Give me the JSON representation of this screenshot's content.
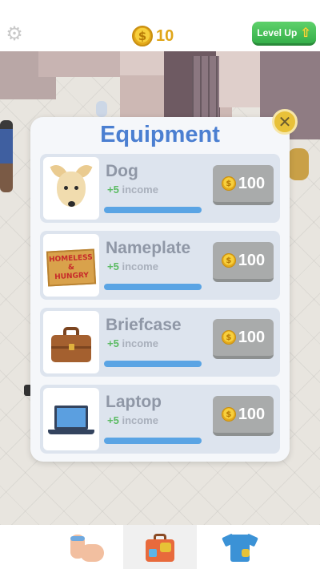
{
  "hud": {
    "settings_icon": "gear-icon",
    "coin_symbol": "$",
    "coin_balance": "10",
    "level_up_label": "Level Up",
    "level_up_arrow": "⇧"
  },
  "modal": {
    "title": "Equipment",
    "close_symbol": "✕"
  },
  "items": [
    {
      "name": "Dog",
      "income_plus": "+5",
      "income_word": "income",
      "coin_symbol": "$",
      "price": "100",
      "progress": 1.0,
      "icon": "dog-icon"
    },
    {
      "name": "Nameplate",
      "income_plus": "+5",
      "income_word": "income",
      "coin_symbol": "$",
      "price": "100",
      "progress": 1.0,
      "icon": "nameplate-icon",
      "sign_lines": [
        "HOMELESS",
        "&",
        "HUNGRY"
      ]
    },
    {
      "name": "Briefcase",
      "income_plus": "+5",
      "income_word": "income",
      "coin_symbol": "$",
      "price": "100",
      "progress": 1.0,
      "icon": "briefcase-icon"
    },
    {
      "name": "Laptop",
      "income_plus": "+5",
      "income_word": "income",
      "coin_symbol": "$",
      "price": "100",
      "progress": 1.0,
      "icon": "laptop-icon"
    }
  ],
  "nav": {
    "tabs": [
      {
        "icon": "muscle-icon",
        "active": false
      },
      {
        "icon": "equipment-case-icon",
        "active": true
      },
      {
        "icon": "shirt-icon",
        "active": false
      }
    ]
  },
  "colors": {
    "title_blue": "#4b7fd1",
    "income_green": "#5bbb63",
    "progress_blue": "#5aa4e4",
    "buy_button_gray": "#a9abab",
    "level_up_green": "#36b04a",
    "coin_gold": "#e0a619"
  }
}
